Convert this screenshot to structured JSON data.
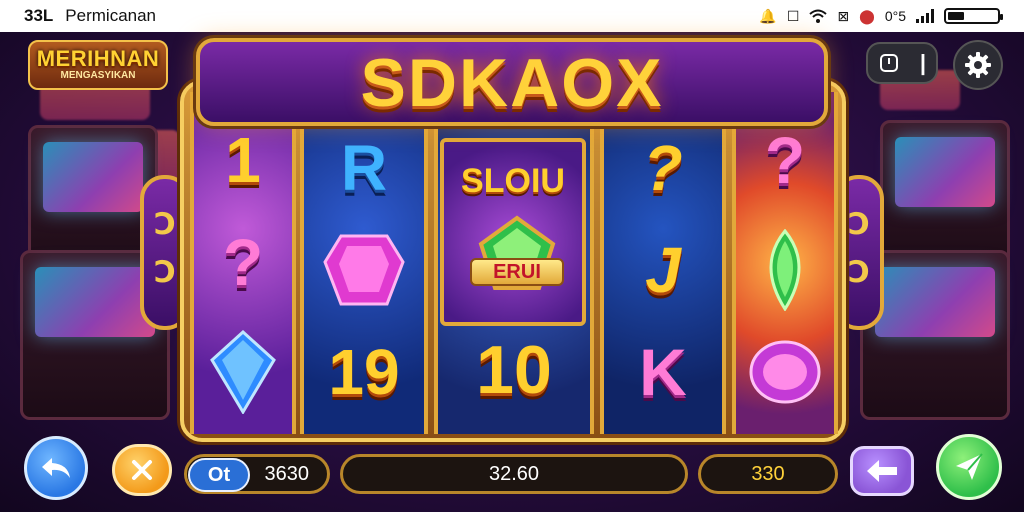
{
  "status_bar": {
    "time": "33L",
    "app_name": "Permicanan",
    "right_text": "0°5"
  },
  "logo": {
    "line1": "MERIHNAN",
    "line2": "MENGASYIKAN"
  },
  "title": "SDKAOX",
  "side_ornament": {
    "glyph1": "ꓛ",
    "glyph2": "ꓛ"
  },
  "reels": {
    "col0": [
      "1",
      "?",
      "gem"
    ],
    "col1": [
      "R",
      "gem",
      "19"
    ],
    "col2": [
      "wild",
      "10"
    ],
    "col3": [
      "?",
      "J",
      "K"
    ],
    "col4": [
      "?",
      "gem",
      "gem"
    ]
  },
  "wild": {
    "title": "SLOIU",
    "ribbon": "ERUI"
  },
  "controls": {
    "coin_badge": "Ot",
    "credit": "3630",
    "win": "32.60",
    "bet": "330"
  },
  "colors": {
    "gold": "#ffcf2e",
    "purple_bg": "#5a1f7a",
    "blue_button": "#2a78e4",
    "orange_button": "#f39a1a",
    "purple_button": "#8a55d6",
    "green_button": "#2fbf4a"
  }
}
